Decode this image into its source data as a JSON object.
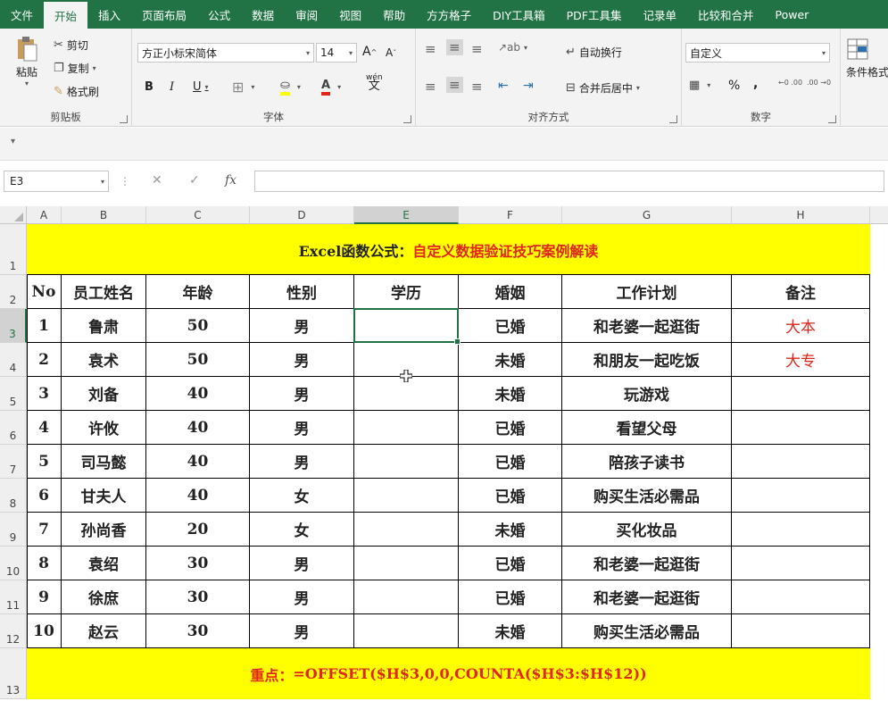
{
  "tabs": [
    "文件",
    "开始",
    "插入",
    "页面布局",
    "公式",
    "数据",
    "审阅",
    "视图",
    "帮助",
    "方方格子",
    "DIY工具箱",
    "PDF工具集",
    "记录单",
    "比较和合并",
    "Power"
  ],
  "ribbon": {
    "clipboard": {
      "paste": "粘贴",
      "cut": "剪切",
      "copy": "复制",
      "format_painter": "格式刷",
      "label": "剪贴板"
    },
    "font": {
      "name": "方正小标宋简体",
      "size": "14",
      "bold": "B",
      "italic": "I",
      "underline": "U",
      "label": "字体",
      "grow": "A",
      "shrink": "A",
      "font_color": "A",
      "wen": "wén",
      "wen_char": "文"
    },
    "align": {
      "wrap": "自动换行",
      "merge": "合并后居中",
      "label": "对齐方式"
    },
    "number": {
      "format": "自定义",
      "percent": "%",
      "comma": ",",
      "label": "数字",
      "inc": "←0 .00",
      "dec": ".00 →0"
    },
    "styles": {
      "cond": "条件格式"
    }
  },
  "formula_bar": {
    "name_box": "E3",
    "fx": "fx",
    "cancel": "✕",
    "confirm": "✓",
    "content": ""
  },
  "columns": [
    "A",
    "B",
    "C",
    "D",
    "E",
    "F",
    "G",
    "H"
  ],
  "rows": [
    "1",
    "2",
    "3",
    "4",
    "5",
    "6",
    "7",
    "8",
    "9",
    "10",
    "11",
    "12",
    "13"
  ],
  "sheet": {
    "title_black": "Excel函数公式：",
    "title_red": "自定义数据验证技巧案例解读",
    "headers": [
      "No",
      "员工姓名",
      "年龄",
      "性别",
      "学历",
      "婚姻",
      "工作计划",
      "备注"
    ],
    "data": [
      [
        "1",
        "鲁肃",
        "50",
        "男",
        "",
        "已婚",
        "和老婆一起逛街",
        "大本"
      ],
      [
        "2",
        "袁术",
        "50",
        "男",
        "",
        "未婚",
        "和朋友一起吃饭",
        "大专"
      ],
      [
        "3",
        "刘备",
        "40",
        "男",
        "",
        "未婚",
        "玩游戏",
        ""
      ],
      [
        "4",
        "许攸",
        "40",
        "男",
        "",
        "已婚",
        "看望父母",
        ""
      ],
      [
        "5",
        "司马懿",
        "40",
        "男",
        "",
        "已婚",
        "陪孩子读书",
        ""
      ],
      [
        "6",
        "甘夫人",
        "40",
        "女",
        "",
        "已婚",
        "购买生活必需品",
        ""
      ],
      [
        "7",
        "孙尚香",
        "20",
        "女",
        "",
        "未婚",
        "买化妆品",
        ""
      ],
      [
        "8",
        "袁绍",
        "30",
        "男",
        "",
        "已婚",
        "和老婆一起逛街",
        ""
      ],
      [
        "9",
        "徐庶",
        "30",
        "男",
        "",
        "已婚",
        "和老婆一起逛街",
        ""
      ],
      [
        "10",
        "赵云",
        "30",
        "男",
        "",
        "未婚",
        "购买生活必需品",
        ""
      ]
    ],
    "footer_black": "重点：",
    "footer_red": "=OFFSET($H$3,0,0,COUNTA($H$3:$H$12))"
  }
}
